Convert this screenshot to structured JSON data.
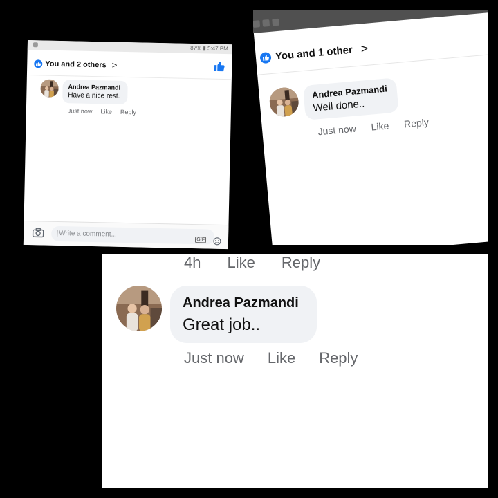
{
  "colors": {
    "facebook_blue": "#1877f2",
    "bubble": "#f0f2f5",
    "meta_text": "#65676b"
  },
  "panel1": {
    "status": {
      "right_text": "87% ▮ 5:47 PM"
    },
    "reactions_label": "You and 2 others",
    "comment": {
      "author": "Andrea Pazmandi",
      "text": "Have a nice rest."
    },
    "actions": {
      "time": "Just now",
      "like": "Like",
      "reply": "Reply"
    },
    "composer": {
      "placeholder": "Write a comment...",
      "gif": "GIF"
    },
    "icons": [
      "like-badge-icon",
      "thumbs-up-icon",
      "camera-icon",
      "smiley-icon",
      "chevron-right-icon"
    ]
  },
  "panel2": {
    "reactions_label": "You and 1 other",
    "comment": {
      "author": "Andrea Pazmandi",
      "text": "Well done.."
    },
    "actions": {
      "time": "Just now",
      "like": "Like",
      "reply": "Reply"
    },
    "icons": [
      "facebook-icon",
      "image-icon",
      "video-icon",
      "like-badge-icon",
      "chevron-right-icon"
    ]
  },
  "panel3": {
    "previous_actions": {
      "time": "4h",
      "like": "Like",
      "reply": "Reply"
    },
    "comment": {
      "author": "Andrea Pazmandi",
      "text": "Great job.."
    },
    "actions": {
      "time": "Just now",
      "like": "Like",
      "reply": "Reply"
    }
  }
}
